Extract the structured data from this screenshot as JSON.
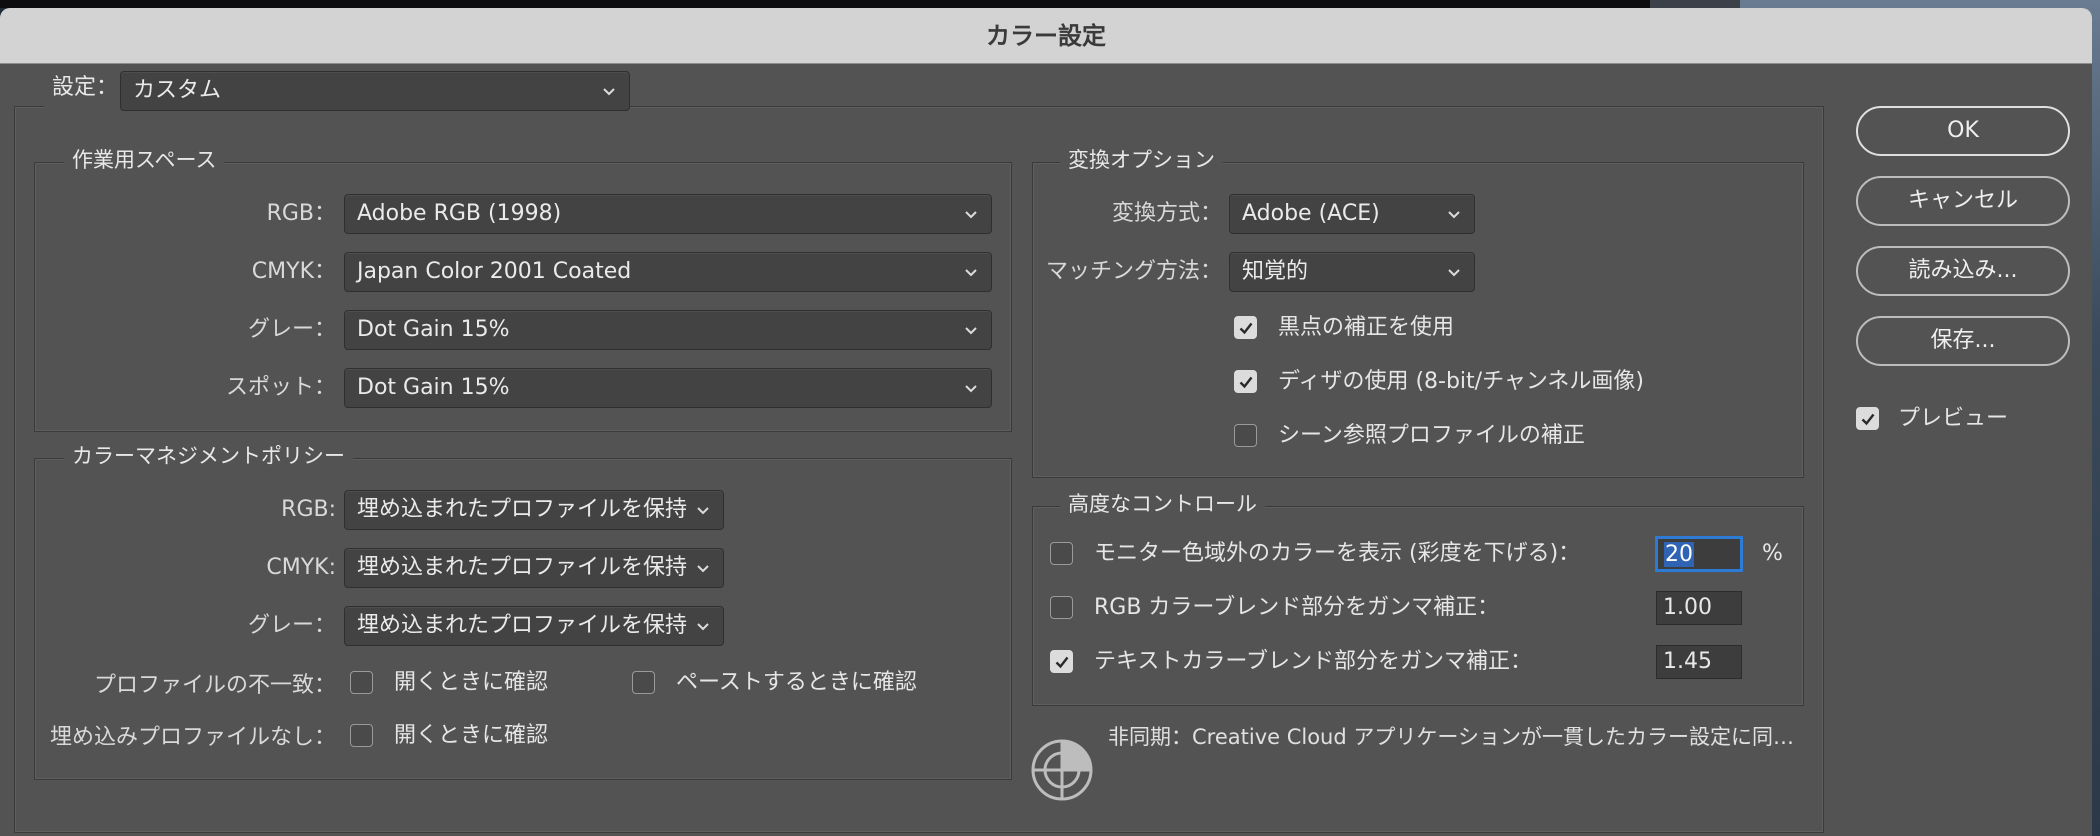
{
  "window": {
    "title": "カラー設定"
  },
  "settings": {
    "label": "設定：",
    "value": "カスタム"
  },
  "working_spaces": {
    "legend": "作業用スペース",
    "rows": [
      {
        "label": "RGB：",
        "value": "Adobe RGB (1998)"
      },
      {
        "label": "CMYK：",
        "value": "Japan Color 2001 Coated"
      },
      {
        "label": "グレー：",
        "value": "Dot Gain 15%"
      },
      {
        "label": "スポット：",
        "value": "Dot Gain 15%"
      }
    ]
  },
  "policies": {
    "legend": "カラーマネジメントポリシー",
    "rows": [
      {
        "label": "RGB:",
        "value": "埋め込まれたプロファイルを保持"
      },
      {
        "label": "CMYK:",
        "value": "埋め込まれたプロファイルを保持"
      },
      {
        "label": "グレー：",
        "value": "埋め込まれたプロファイルを保持"
      }
    ],
    "mismatch_label": "プロファイルの不一致：",
    "mismatch_open": {
      "label": "開くときに確認",
      "checked": false
    },
    "mismatch_paste": {
      "label": "ペーストするときに確認",
      "checked": false
    },
    "missing_label": "埋め込みプロファイルなし：",
    "missing_open": {
      "label": "開くときに確認",
      "checked": false
    }
  },
  "conversion": {
    "legend": "変換オプション",
    "engine_label": "変換方式：",
    "engine_value": "Adobe (ACE)",
    "intent_label": "マッチング方法：",
    "intent_value": "知覚的",
    "bpc": {
      "label": "黒点の補正を使用",
      "checked": true
    },
    "dither": {
      "label": "ディザの使用 (8-bit/チャンネル画像)",
      "checked": true
    },
    "scene": {
      "label": "シーン参照プロファイルの補正",
      "checked": false
    }
  },
  "advanced": {
    "legend": "高度なコントロール",
    "desaturate": {
      "label": "モニター色域外のカラーを表示 (彩度を下げる)：",
      "checked": false,
      "value": "20",
      "unit": "%"
    },
    "rgb_blend": {
      "label": "RGB カラーブレンド部分をガンマ補正：",
      "checked": false,
      "value": "1.00"
    },
    "text_blend": {
      "label": "テキストカラーブレンド部分をガンマ補正：",
      "checked": true,
      "value": "1.45"
    }
  },
  "sync": {
    "text": "非同期：Creative Cloud アプリケーションが一貫したカラー設定に同…"
  },
  "buttons": {
    "ok": "OK",
    "cancel": "キャンセル",
    "load": "読み込み...",
    "save": "保存..."
  },
  "preview": {
    "label": "プレビュー",
    "checked": true
  },
  "colors": {
    "dialog_bg": "#535353",
    "titlebar_bg": "#d3d3d3",
    "focus": "#2e7bd6"
  },
  "icons": [
    "chevron-down-icon",
    "checkmark-icon",
    "color-sync-icon"
  ]
}
